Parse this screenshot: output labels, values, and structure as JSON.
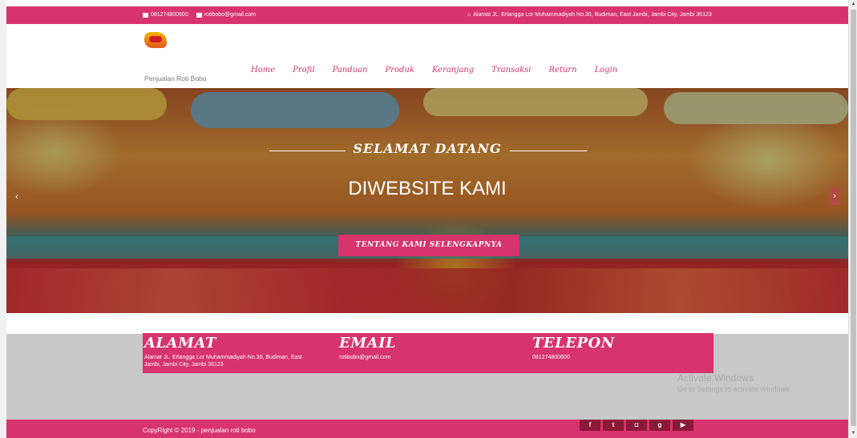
{
  "topbar": {
    "phone": "081274800600",
    "email": "rotibobo@gmail.com",
    "address": "Alamat JL. Erlangga Lor Muhammadiyah No.30, Budiman, East Jambi, Jambi City, Jambi 36123"
  },
  "header": {
    "brand": "Penjualan Roti Bobo",
    "nav": [
      "Home",
      "Profil",
      "Panduan",
      "Produk",
      "Keranjang",
      "Transaksi",
      "Return",
      "Login"
    ]
  },
  "hero": {
    "welcome": "SELAMAT DATANG",
    "title": "DIWEBSITE KAMI",
    "cta": "TENTANG KAMI SELENGKAPNYA",
    "prev_arrow": "‹",
    "next_arrow": "›"
  },
  "info": {
    "alamat_title": "ALAMAT",
    "alamat_text": "Alamat JL. Erlangga Lor Muhammadiyah No.30, Budiman, East Jambi, Jambi City, Jambi 36123",
    "email_title": "EMAIL",
    "email_text": "rotibobo@gmail.com",
    "telepon_title": "TELEPON",
    "telepon_text": "081274800600"
  },
  "watermark": {
    "line1": "Activate Windows",
    "line2": "Go to Settings to activate Windows."
  },
  "footer": {
    "copyright": "CopyRight © 2019 - penjualan roti bobo",
    "social": [
      "f",
      "t",
      "ig",
      "g+",
      "yt"
    ]
  },
  "colors": {
    "accent": "#d7336c",
    "gray": "#c8c8c8"
  }
}
